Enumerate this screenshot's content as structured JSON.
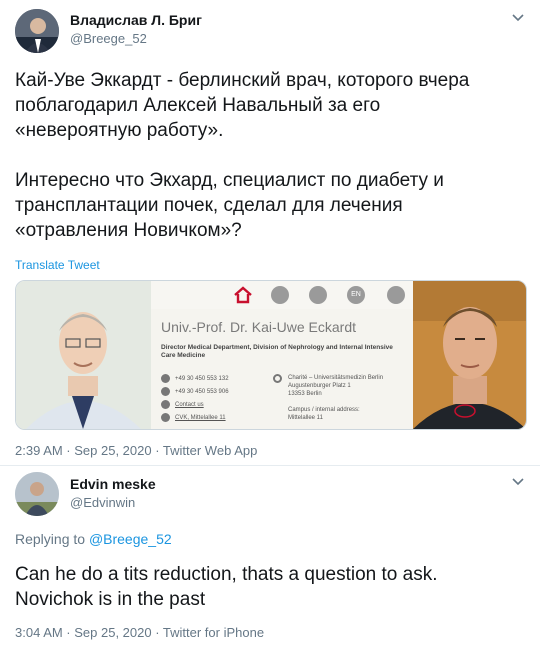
{
  "tweet": {
    "author_name": "Владислав Л. Бриг",
    "author_handle": "@Breege_52",
    "text": "Кай-Уве Эккардт - берлинский врач, которого вчера\nпоблагодарил Алексей Навальный за его\n«невероятную работу».\n\nИнтересно что Экхард, специалист по диабету и\nтрансплантации почек, сделал для лечения\n«отравления Новичком»?",
    "translate_label": "Translate Tweet",
    "timestamp": "2:39 AM · Sep 25, 2020 · Twitter Web App",
    "media": {
      "prof_title": "Univ.-Prof. Dr. Kai-Uwe Eckardt",
      "position": "Director Medical Department, Division of Nephrology and Internal Intensive Care Medicine",
      "phone": "+49 30 450 553 132",
      "fax": "+49 30 450 553 906",
      "contact": "Contact us",
      "cvk": "CVK, Mittelallee 11",
      "address_line1": "Charité – Universitätsmedizin Berlin",
      "address_line2": "Augustenburger Platz 1",
      "address_line3": "13353 Berlin",
      "campus_line1": "Campus / internal address:",
      "campus_line2": "Mittelallee 11",
      "lang": "EN",
      "accent_red": "#c8102e"
    }
  },
  "reply": {
    "author_name": "Edvin meske",
    "author_handle": "@Edvinwin",
    "replying_prefix": "Replying to",
    "replying_handle": "@Breege_52",
    "text": "Can he do a tits reduction, thats a question to ask.\nNovichok is in the past",
    "timestamp": "3:04 AM · Sep 25, 2020 · Twitter for iPhone"
  }
}
